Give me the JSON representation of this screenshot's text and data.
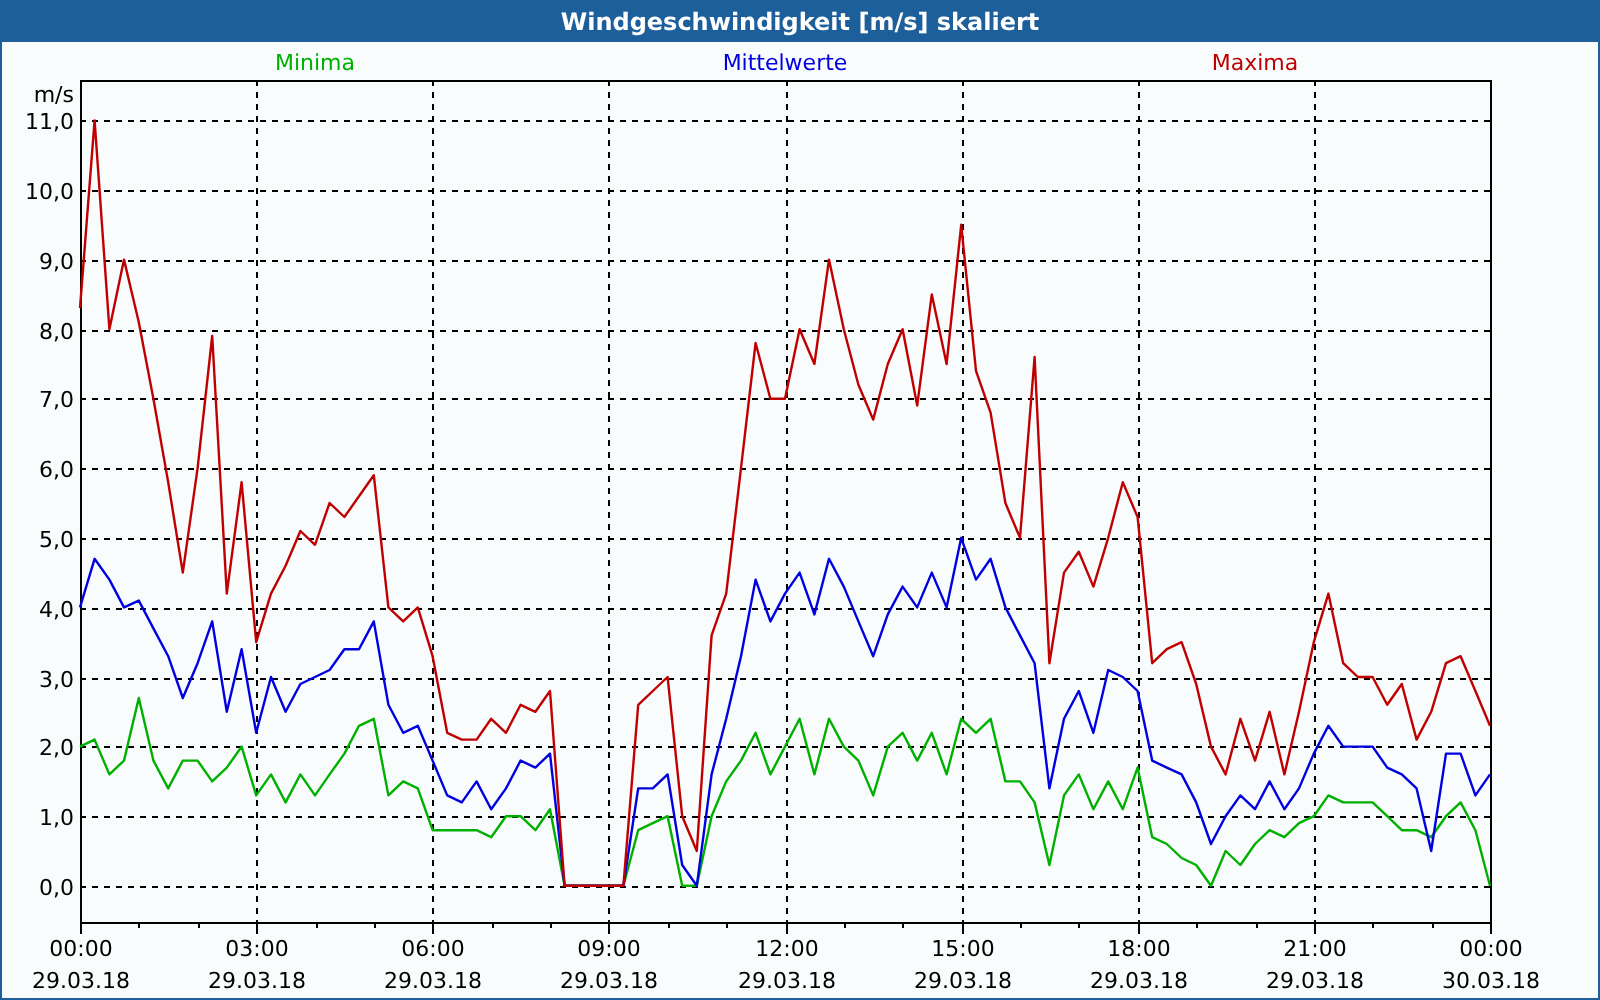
{
  "window": {
    "title": "Windgeschwindigkeit [m/s] skaliert"
  },
  "chart": {
    "chart_data": {
      "type": "line",
      "grid": true,
      "ylabel": "m/s",
      "ylim": [
        -0.52,
        11.58
      ],
      "yticks": [
        {
          "value": 0,
          "label": "0,0"
        },
        {
          "value": 1,
          "label": "1,0"
        },
        {
          "value": 2,
          "label": "2,0"
        },
        {
          "value": 3,
          "label": "3,0"
        },
        {
          "value": 4,
          "label": "4,0"
        },
        {
          "value": 5,
          "label": "5,0"
        },
        {
          "value": 6,
          "label": "6,0"
        },
        {
          "value": 7,
          "label": "7,0"
        },
        {
          "value": 8,
          "label": "8,0"
        },
        {
          "value": 9,
          "label": "9,0"
        },
        {
          "value": 10,
          "label": "10,0"
        },
        {
          "value": 11,
          "label": "11,0"
        }
      ],
      "categories": [
        "00:00\n29.03.18",
        null,
        null,
        null,
        null,
        null,
        null,
        null,
        null,
        null,
        null,
        null,
        "03:00\n29.03.18",
        null,
        null,
        null,
        null,
        null,
        null,
        null,
        null,
        null,
        null,
        null,
        "06:00\n29.03.18",
        null,
        null,
        null,
        null,
        null,
        null,
        null,
        null,
        null,
        null,
        null,
        "09:00\n29.03.18",
        null,
        null,
        null,
        null,
        null,
        null,
        null,
        null,
        null,
        null,
        null,
        "12:00\n29.03.18",
        null,
        null,
        null,
        null,
        null,
        null,
        null,
        null,
        null,
        null,
        null,
        "15:00\n29.03.18",
        null,
        null,
        null,
        null,
        null,
        null,
        null,
        null,
        null,
        null,
        null,
        "18:00\n29.03.18",
        null,
        null,
        null,
        null,
        null,
        null,
        null,
        null,
        null,
        null,
        null,
        "21:00\n29.03.18",
        null,
        null,
        null,
        null,
        null,
        null,
        null,
        null,
        null,
        null,
        null,
        "00:00\n30.03.18"
      ],
      "series": [
        {
          "name": "Minima",
          "color": "#00b000",
          "values": [
            2.0,
            2.1,
            1.6,
            1.8,
            2.7,
            1.8,
            1.4,
            1.8,
            1.8,
            1.5,
            1.7,
            2.0,
            1.3,
            1.6,
            1.2,
            1.6,
            1.3,
            1.6,
            1.9,
            2.3,
            2.4,
            1.3,
            1.5,
            1.4,
            0.8,
            0.8,
            0.8,
            0.8,
            0.7,
            1.0,
            1.0,
            0.8,
            1.1,
            0,
            0,
            0,
            0,
            0,
            0.8,
            0.9,
            1.0,
            0,
            0,
            1.0,
            1.5,
            1.8,
            2.2,
            1.6,
            2.0,
            2.4,
            1.6,
            2.4,
            2.0,
            1.8,
            1.3,
            2.0,
            2.2,
            1.8,
            2.2,
            1.6,
            2.4,
            2.2,
            2.4,
            1.5,
            1.5,
            1.2,
            0.3,
            1.3,
            1.6,
            1.1,
            1.5,
            1.1,
            1.7,
            0.7,
            0.6,
            0.4,
            0.3,
            0,
            0.5,
            0.3,
            0.6,
            0.8,
            0.7,
            0.9,
            1.0,
            1.3,
            1.2,
            1.2,
            1.2,
            1.0,
            0.8,
            0.8,
            0.7,
            1.0,
            1.2,
            0.8,
            0.0
          ]
        },
        {
          "name": "Mittelwerte",
          "color": "#0000e0",
          "values": [
            4.0,
            4.7,
            4.4,
            4.0,
            4.1,
            3.7,
            3.3,
            2.7,
            3.2,
            3.8,
            2.5,
            3.4,
            2.2,
            3.0,
            2.5,
            2.9,
            3.0,
            3.1,
            3.4,
            3.4,
            3.8,
            2.6,
            2.2,
            2.3,
            1.8,
            1.3,
            1.2,
            1.5,
            1.1,
            1.4,
            1.8,
            1.7,
            1.9,
            0,
            0,
            0,
            0,
            0,
            1.4,
            1.4,
            1.6,
            0.3,
            0,
            1.6,
            2.4,
            3.3,
            4.4,
            3.8,
            4.2,
            4.5,
            3.9,
            4.7,
            4.3,
            3.8,
            3.3,
            3.9,
            4.3,
            4.0,
            4.5,
            4.0,
            5.0,
            4.4,
            4.7,
            4.0,
            3.6,
            3.2,
            1.4,
            2.4,
            2.8,
            2.2,
            3.1,
            3.0,
            2.8,
            1.8,
            1.7,
            1.6,
            1.2,
            0.6,
            1.0,
            1.3,
            1.1,
            1.5,
            1.1,
            1.4,
            1.9,
            2.3,
            2.0,
            2.0,
            2.0,
            1.7,
            1.6,
            1.4,
            0.5,
            1.9,
            1.9,
            1.3,
            1.6
          ]
        },
        {
          "name": "Maxima",
          "color": "#c00000",
          "values": [
            8.3,
            11.0,
            8.0,
            9.0,
            8.1,
            7.0,
            5.8,
            4.5,
            6.0,
            7.9,
            4.2,
            5.8,
            3.5,
            4.2,
            4.6,
            5.1,
            4.9,
            5.5,
            5.3,
            5.6,
            5.9,
            4.0,
            3.8,
            4.0,
            3.3,
            2.2,
            2.1,
            2.1,
            2.4,
            2.2,
            2.6,
            2.5,
            2.8,
            0,
            0,
            0,
            0,
            0,
            2.6,
            2.8,
            3.0,
            1.0,
            0.5,
            3.6,
            4.2,
            6.0,
            7.8,
            7.0,
            7.0,
            8.0,
            7.5,
            9.0,
            8.0,
            7.2,
            6.7,
            7.5,
            8.0,
            6.9,
            8.5,
            7.5,
            9.5,
            7.4,
            6.8,
            5.5,
            5.0,
            7.6,
            3.2,
            4.5,
            4.8,
            4.3,
            5.0,
            5.8,
            5.3,
            3.2,
            3.4,
            3.5,
            2.9,
            2.0,
            1.6,
            2.4,
            1.8,
            2.5,
            1.6,
            2.5,
            3.5,
            4.2,
            3.2,
            3.0,
            3.0,
            2.6,
            2.9,
            2.1,
            2.5,
            3.2,
            3.3,
            2.8,
            2.3
          ]
        }
      ]
    }
  }
}
